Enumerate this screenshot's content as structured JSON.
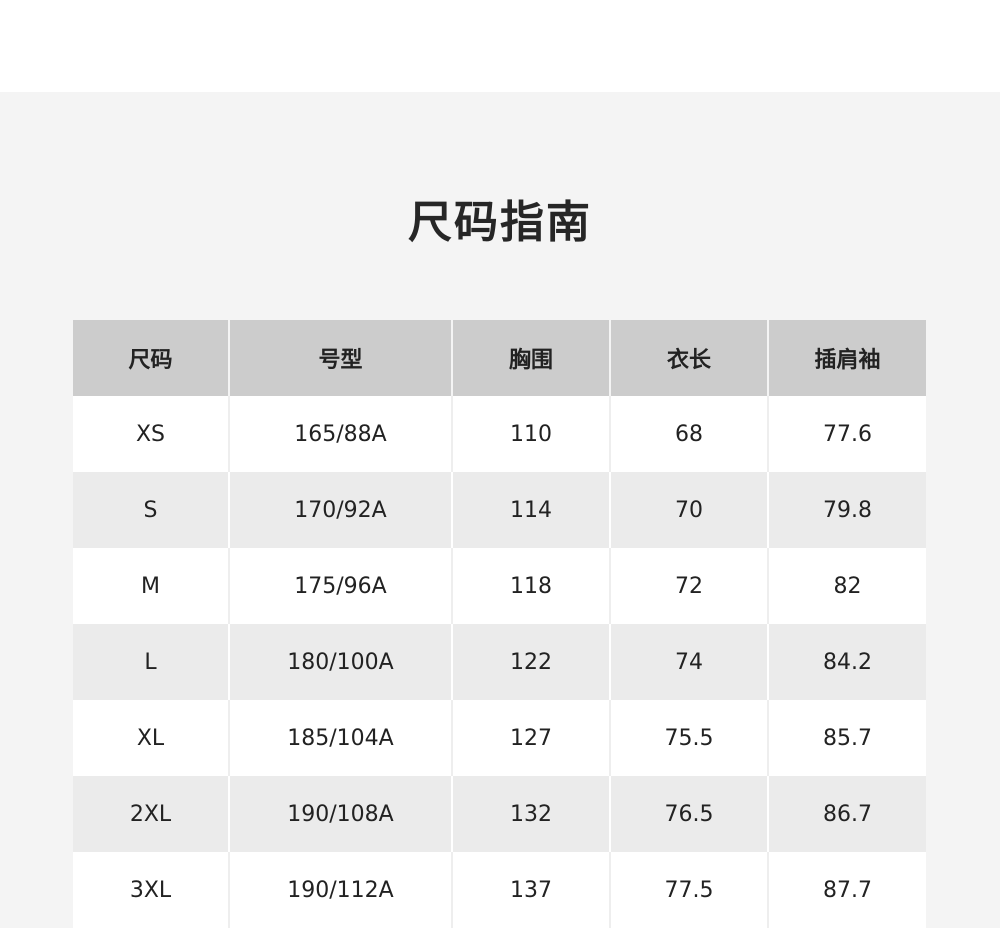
{
  "title": "尺码指南",
  "table": {
    "headers": [
      "尺码",
      "号型",
      "胸围",
      "衣长",
      "插肩袖"
    ],
    "rows": [
      [
        "XS",
        "165/88A",
        "110",
        "68",
        "77.6"
      ],
      [
        "S",
        "170/92A",
        "114",
        "70",
        "79.8"
      ],
      [
        "M",
        "175/96A",
        "118",
        "72",
        "82"
      ],
      [
        "L",
        "180/100A",
        "122",
        "74",
        "84.2"
      ],
      [
        "XL",
        "185/104A",
        "127",
        "75.5",
        "85.7"
      ],
      [
        "2XL",
        "190/108A",
        "132",
        "76.5",
        "86.7"
      ],
      [
        "3XL",
        "190/112A",
        "137",
        "77.5",
        "87.7"
      ]
    ]
  }
}
